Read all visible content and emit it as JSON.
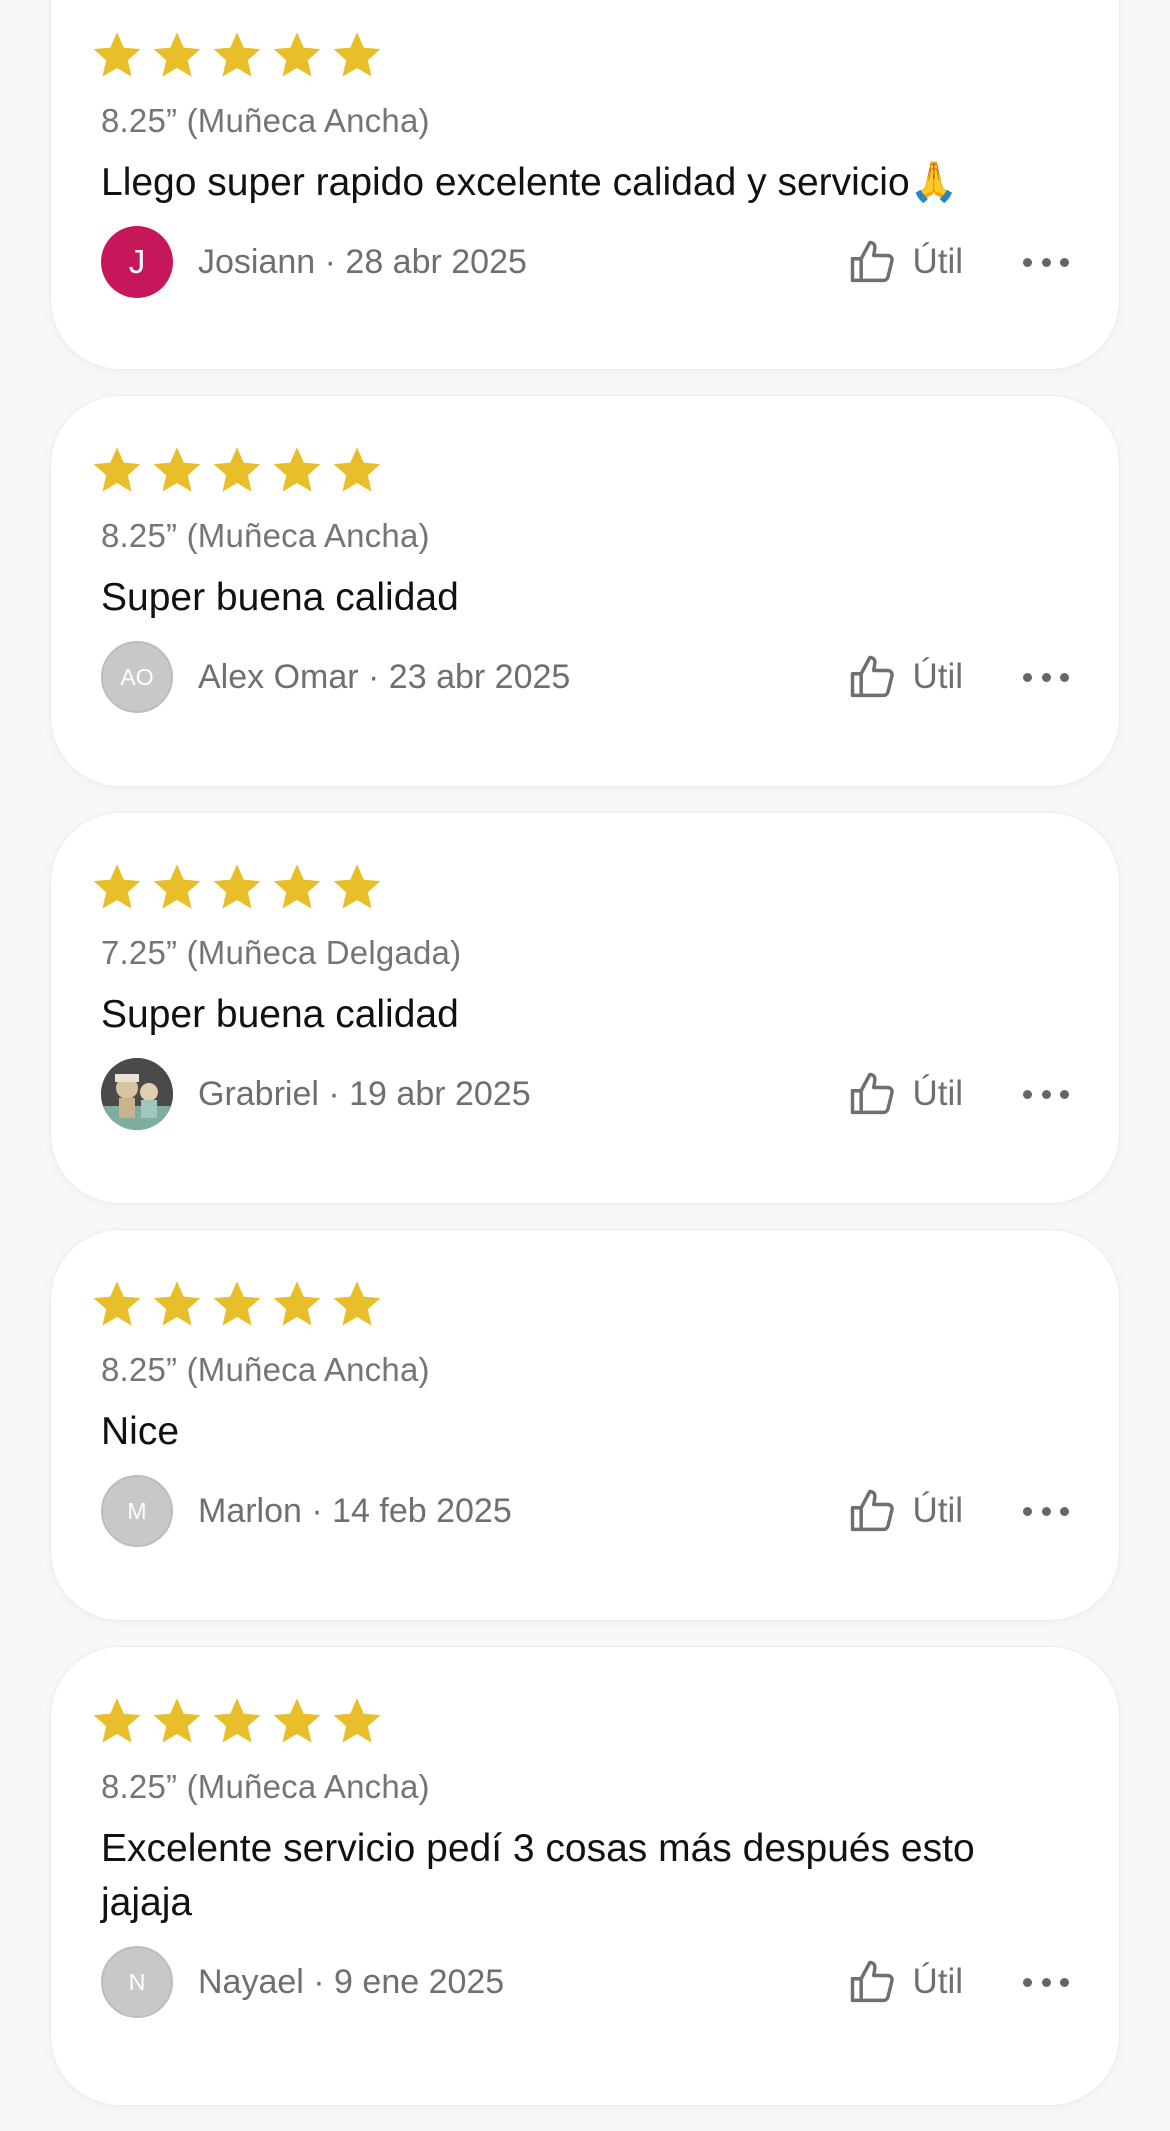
{
  "colors": {
    "star": "#e8be2a",
    "avatar_red": "#c6175a",
    "avatar_gray": "#c8c8c8"
  },
  "reviews": [
    {
      "rating": 5,
      "variant": "8.25” (Muñeca Ancha)",
      "text": "Llego super rapido excelente calidad y servicio🙏",
      "reviewer": "Josiann · 28 abr 2025",
      "avatar_initials": "J",
      "helpful_label": "Útil"
    },
    {
      "rating": 5,
      "variant": "8.25” (Muñeca Ancha)",
      "text": "Super buena calidad",
      "reviewer": "Alex Omar · 23 abr 2025",
      "avatar_initials": "AO",
      "helpful_label": "Útil"
    },
    {
      "rating": 5,
      "variant": "7.25” (Muñeca Delgada)",
      "text": "Super buena calidad",
      "reviewer": "Grabriel · 19 abr 2025",
      "avatar_initials": "",
      "helpful_label": "Útil"
    },
    {
      "rating": 5,
      "variant": "8.25” (Muñeca Ancha)",
      "text": "Nice",
      "reviewer": "Marlon · 14 feb 2025",
      "avatar_initials": "M",
      "helpful_label": "Útil"
    },
    {
      "rating": 5,
      "variant": "8.25” (Muñeca Ancha)",
      "text": "Excelente servicio pedí 3 cosas más después esto jajaja",
      "reviewer": "Nayael · 9 ene 2025",
      "avatar_initials": "N",
      "helpful_label": "Útil"
    }
  ]
}
